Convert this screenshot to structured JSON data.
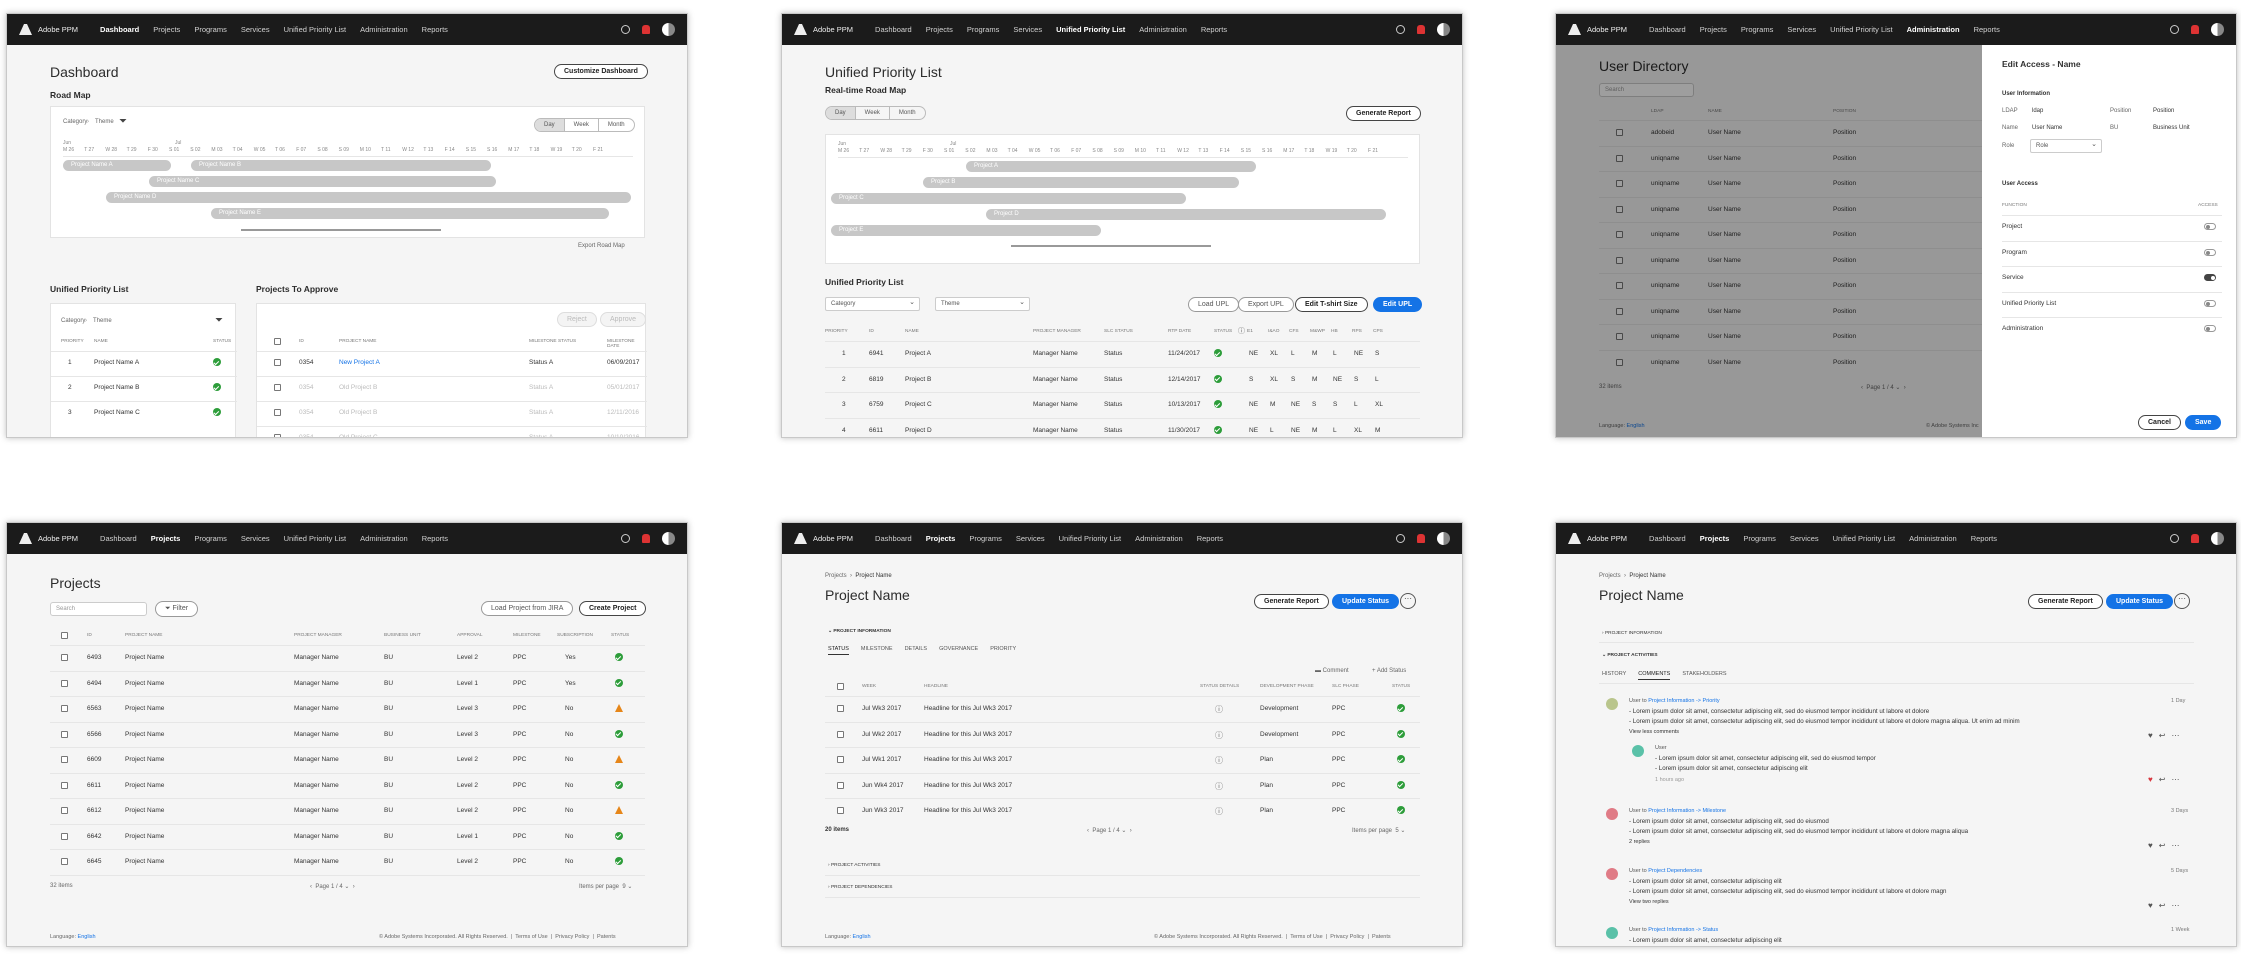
{
  "topbar": {
    "app": "Adobe PPM",
    "nav": [
      "Dashboard",
      "Projects",
      "Programs",
      "Services",
      "Unified Priority List",
      "Administration",
      "Reports"
    ]
  },
  "dashboard": {
    "title": "Dashboard",
    "customize": "Customize Dashboard",
    "roadmap_title": "Road Map",
    "filter_category": "Category",
    "filter_theme": "Theme",
    "views": [
      "Day",
      "Week",
      "Month"
    ],
    "months": [
      "Jun",
      "Jul"
    ],
    "days": [
      "M 26",
      "T 27",
      "W 28",
      "T 29",
      "F 30",
      "S 01",
      "S 02",
      "M 03",
      "T 04",
      "W 05",
      "T 06",
      "F 07",
      "S 08",
      "S 09",
      "M 10",
      "T 11",
      "W 12",
      "T 13",
      "F 14",
      "S 15",
      "S 16",
      "M 17",
      "T 18",
      "W 19",
      "T 20",
      "F 21"
    ],
    "bars": [
      "Project Name A",
      "Project Name B",
      "Project Name C",
      "Project Name D",
      "Project Name E"
    ],
    "export": "Export Road Map",
    "upl_title": "Unified Priority List",
    "upl_cols": [
      "Priority",
      "Name",
      "Status"
    ],
    "upl_rows": [
      {
        "p": "1",
        "n": "Project Name A"
      },
      {
        "p": "2",
        "n": "Project Name B"
      },
      {
        "p": "3",
        "n": "Project Name C"
      }
    ],
    "approve_title": "Projects To Approve",
    "reject": "Reject",
    "approve": "Approve",
    "approve_cols": [
      "ID",
      "Project Name",
      "Milestone Status",
      "Milestone Date"
    ],
    "approve_rows": [
      {
        "id": "0354",
        "n": "New Project A",
        "s": "Status A",
        "d": "06/09/2017"
      },
      {
        "id": "0354",
        "n": "Old Project B",
        "s": "Status A",
        "d": "05/01/2017"
      },
      {
        "id": "0354",
        "n": "Old Project B",
        "s": "Status A",
        "d": "12/11/2016"
      },
      {
        "id": "0354",
        "n": "Old Project C",
        "s": "Status A",
        "d": "10/10/2016"
      }
    ]
  },
  "upl": {
    "title": "Unified Priority List",
    "rm_title": "Real-time Road Map",
    "generate": "Generate Report",
    "bars": [
      "Project A",
      "Project B",
      "Project C",
      "Project D",
      "Project E"
    ],
    "list_title": "Unified Priority List",
    "category": "Category",
    "theme": "Theme",
    "load": "Load UPL",
    "export": "Export UPL",
    "tshirt": "Edit T-shirt Size",
    "edit": "Edit UPL",
    "cols": [
      "Priority",
      "ID",
      "Name",
      "Project Manager",
      "SLC Status",
      "RTP Date",
      "Status",
      "E1",
      "I&AO",
      "CFS",
      "M&WP",
      "HB",
      "RPS",
      "CPS"
    ],
    "rows": [
      {
        "p": "1",
        "id": "6941",
        "n": "Project A",
        "m": "Manager Name",
        "s": "Status",
        "d": "11/24/2017",
        "v": [
          "NE",
          "XL",
          "L",
          "M",
          "L",
          "NE",
          "S"
        ]
      },
      {
        "p": "2",
        "id": "6819",
        "n": "Project B",
        "m": "Manager Name",
        "s": "Status",
        "d": "12/14/2017",
        "v": [
          "S",
          "XL",
          "S",
          "M",
          "NE",
          "S",
          "L"
        ]
      },
      {
        "p": "3",
        "id": "6759",
        "n": "Project C",
        "m": "Manager Name",
        "s": "Status",
        "d": "10/13/2017",
        "v": [
          "NE",
          "M",
          "NE",
          "S",
          "S",
          "L",
          "XL"
        ]
      },
      {
        "p": "4",
        "id": "6611",
        "n": "Project D",
        "m": "Manager Name",
        "s": "Status",
        "d": "11/30/2017",
        "v": [
          "NE",
          "L",
          "NE",
          "M",
          "L",
          "XL",
          "M"
        ]
      }
    ]
  },
  "admin": {
    "title": "User Directory",
    "search": "Search",
    "cols": [
      "LDAP",
      "Name",
      "Position"
    ],
    "rows": [
      {
        "l": "adobeid",
        "n": "User Name",
        "p": "Position"
      },
      {
        "l": "uniqname",
        "n": "User Name",
        "p": "Position"
      },
      {
        "l": "uniqname",
        "n": "User Name",
        "p": "Position"
      },
      {
        "l": "uniqname",
        "n": "User Name",
        "p": "Position"
      },
      {
        "l": "uniqname",
        "n": "User Name",
        "p": "Position"
      },
      {
        "l": "uniqname",
        "n": "User Name",
        "p": "Position"
      },
      {
        "l": "uniqname",
        "n": "User Name",
        "p": "Position"
      },
      {
        "l": "uniqname",
        "n": "User Name",
        "p": "Position"
      },
      {
        "l": "uniqname",
        "n": "User Name",
        "p": "Position"
      },
      {
        "l": "uniqname",
        "n": "User Name",
        "p": "Position"
      }
    ],
    "count": "32 items",
    "page": "Page",
    "page_val": "1 / 4",
    "lang_label": "Language:",
    "lang": "English",
    "copy": "© Adobe Systems Inc",
    "panel_title": "Edit Access - Name",
    "info": "User Information",
    "fields": [
      {
        "k": "LDAP",
        "v": "ldap"
      },
      {
        "k": "Position",
        "v": "Position"
      },
      {
        "k": "Name",
        "v": "User Name"
      },
      {
        "k": "BU",
        "v": "Business Unit"
      },
      {
        "k": "Role",
        "v": "Role"
      }
    ],
    "access": "User Access",
    "fn": "Function",
    "acc": "Access",
    "functions": [
      {
        "f": "Project",
        "on": false
      },
      {
        "f": "Program",
        "on": false
      },
      {
        "f": "Service",
        "on": true
      },
      {
        "f": "Unified Priority List",
        "on": false
      },
      {
        "f": "Administration",
        "on": false
      }
    ],
    "cancel": "Cancel",
    "save": "Save"
  },
  "projects": {
    "title": "Projects",
    "search": "Search",
    "filter": "Filter",
    "load": "Load Project from JIRA",
    "create": "Create Project",
    "cols": [
      "ID",
      "Project Name",
      "Project Manager",
      "Business Unit",
      "Approval",
      "Milestone",
      "Subscription",
      "Status"
    ],
    "rows": [
      {
        "id": "6493",
        "n": "Project Name",
        "m": "Manager Name",
        "b": "BU",
        "a": "Level 2",
        "ms": "PPC",
        "s": "Yes",
        "st": "ok"
      },
      {
        "id": "6494",
        "n": "Project Name",
        "m": "Manager Name",
        "b": "BU",
        "a": "Level 1",
        "ms": "PPC",
        "s": "Yes",
        "st": "ok"
      },
      {
        "id": "6563",
        "n": "Project Name",
        "m": "Manager Name",
        "b": "BU",
        "a": "Level 3",
        "ms": "PPC",
        "s": "No",
        "st": "warn"
      },
      {
        "id": "6566",
        "n": "Project Name",
        "m": "Manager Name",
        "b": "BU",
        "a": "Level 3",
        "ms": "PPC",
        "s": "No",
        "st": "ok"
      },
      {
        "id": "6609",
        "n": "Project Name",
        "m": "Manager Name",
        "b": "BU",
        "a": "Level 2",
        "ms": "PPC",
        "s": "No",
        "st": "warn"
      },
      {
        "id": "6611",
        "n": "Project Name",
        "m": "Manager Name",
        "b": "BU",
        "a": "Level 2",
        "ms": "PPC",
        "s": "No",
        "st": "ok"
      },
      {
        "id": "6612",
        "n": "Project Name",
        "m": "Manager Name",
        "b": "BU",
        "a": "Level 2",
        "ms": "PPC",
        "s": "No",
        "st": "warn"
      },
      {
        "id": "6642",
        "n": "Project Name",
        "m": "Manager Name",
        "b": "BU",
        "a": "Level 1",
        "ms": "PPC",
        "s": "No",
        "st": "ok"
      },
      {
        "id": "6645",
        "n": "Project Name",
        "m": "Manager Name",
        "b": "BU",
        "a": "Level 2",
        "ms": "PPC",
        "s": "No",
        "st": "ok"
      }
    ],
    "count": "32 items",
    "page": "Page",
    "page_val": "1 / 4",
    "ipp": "Items per page",
    "ipp_val": "9",
    "lang_label": "Language:",
    "lang": "English",
    "copy": "© Adobe Systems Incorporated. All Rights Reserved.",
    "terms": "Terms of Use",
    "privacy": "Privacy Policy",
    "patents": "Patents"
  },
  "status": {
    "crumb": "Projects",
    "crumb2": "Project Name",
    "title": "Project Name",
    "generate": "Generate Report",
    "update": "Update Status",
    "info": "Project Information",
    "tabs": [
      "Status",
      "Milestone",
      "Details",
      "Governance",
      "Priority"
    ],
    "comment": "Comment",
    "add": "Add Status",
    "cols": [
      "Week",
      "Headline",
      "Status Details",
      "Development Phase",
      "SLC Phase",
      "Status"
    ],
    "rows": [
      {
        "w": "Jul Wk3 2017",
        "h": "Headline for this Jul Wk3 2017",
        "p": "Development",
        "s": "PPC"
      },
      {
        "w": "Jul Wk2 2017",
        "h": "Headline for this Jul Wk3 2017",
        "p": "Development",
        "s": "PPC"
      },
      {
        "w": "Jul Wk1 2017",
        "h": "Headline for this Jul Wk3 2017",
        "p": "Plan",
        "s": "PPC"
      },
      {
        "w": "Jun Wk4 2017",
        "h": "Headline for this Jul Wk3 2017",
        "p": "Plan",
        "s": "PPC"
      },
      {
        "w": "Jun Wk3 2017",
        "h": "Headline for this Jul Wk3 2017",
        "p": "Plan",
        "s": "PPC"
      }
    ],
    "count": "20 items",
    "page": "Page",
    "page_val": "1 / 4",
    "ipp": "Items per page",
    "ipp_val": "5",
    "activities": "Project Activities",
    "deps": "Project Dependencies",
    "lang_label": "Language:",
    "lang": "English",
    "copy": "© Adobe Systems Incorporated. All Rights Reserved.",
    "terms": "Terms of Use",
    "privacy": "Privacy Policy",
    "patents": "Patents"
  },
  "activity": {
    "crumb": "Projects",
    "crumb2": "Project Name",
    "title": "Project Name",
    "generate": "Generate Report",
    "update": "Update Status",
    "info": "Project Information",
    "acts": "Project Activities",
    "tabs": [
      "History",
      "Comments",
      "Stakeholders"
    ],
    "c1": {
      "who": "User to",
      "target": "Project Information -> Priority",
      "when": "1 Day",
      "l1": "Lorem ipsum dolor sit amet, consectetur adipiscing elit, sed do eiusmod tempor incididunt ut labore et dolore",
      "l2": "Lorem ipsum dolor sit amet, consectetur adipiscing elit, sed do eiusmod tempor incididunt ut labore et dolore magna aliqua. Ut enim ad minim",
      "more": "View less comments"
    },
    "c1r": {
      "who": "User",
      "l1": "Lorem ipsum dolor sit amet, consectetur adipiscing elit, sed do eiusmod tempor",
      "l2": "Lorem ipsum dolor sit amet, consectetur adipiscing elit",
      "when": "1 hours ago"
    },
    "c2": {
      "who": "User to",
      "target": "Project Information -> Milestone",
      "when": "3 Days",
      "l1": "Lorem ipsum dolor sit amet, consectetur adipiscing elit, sed do eiusmod",
      "l2": "Lorem ipsum dolor sit amet, consectetur adipiscing elit, sed do eiusmod tempor incididunt ut labore et dolore magna aliqua",
      "more": "2 replies"
    },
    "c3": {
      "who": "User to",
      "target": "Project Dependencies",
      "when": "5 Days",
      "l1": "Lorem ipsum dolor sit amet, consectetur adipiscing elit",
      "l2": "Lorem ipsum dolor sit amet, consectetur adipiscing elit, sed do eiusmod tempor incididunt ut labore et dolore magn",
      "more": "View two replies"
    },
    "c4": {
      "who": "User to",
      "target": "Project Information -> Status",
      "when": "1 Week",
      "l1": "Lorem ipsum dolor sit amet, consectetur adipiscing elit"
    }
  }
}
